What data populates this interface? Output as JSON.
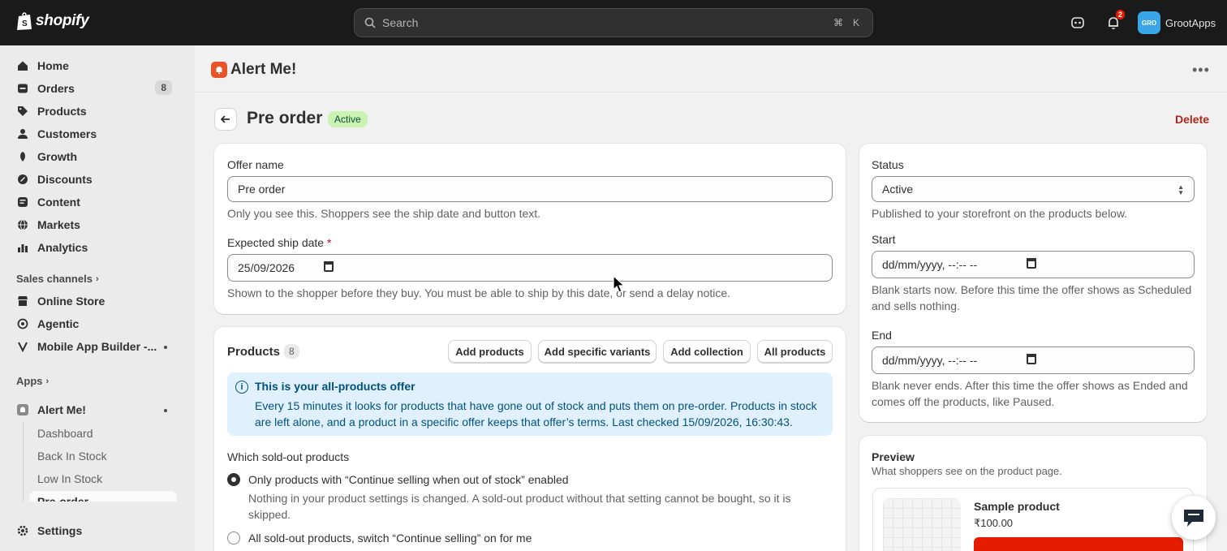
{
  "topbar": {
    "logo_text": "shopify",
    "search_placeholder": "Search",
    "kbd_cmd": "⌘",
    "kbd_k": "K",
    "notification_count": "2",
    "store_initials": "GRO",
    "store_name": "GrootApps"
  },
  "sidebar": {
    "items": [
      {
        "label": "Home",
        "icon": "home-icon"
      },
      {
        "label": "Orders",
        "icon": "orders-icon",
        "count": "8"
      },
      {
        "label": "Products",
        "icon": "tag-icon"
      },
      {
        "label": "Customers",
        "icon": "person-icon"
      },
      {
        "label": "Growth",
        "icon": "growth-icon"
      },
      {
        "label": "Discounts",
        "icon": "discount-icon"
      },
      {
        "label": "Content",
        "icon": "content-icon"
      },
      {
        "label": "Markets",
        "icon": "globe-icon"
      },
      {
        "label": "Analytics",
        "icon": "chart-icon"
      }
    ],
    "sales_channels_label": "Sales channels",
    "channels": [
      {
        "label": "Online Store",
        "icon": "store-icon"
      },
      {
        "label": "Agentic",
        "icon": "agentic-icon"
      },
      {
        "label": "Mobile App Builder -...",
        "icon": "mobile-app-icon"
      }
    ],
    "apps_label": "Apps",
    "app": {
      "label": "Alert Me!",
      "icon": "alert-me-app-icon"
    },
    "app_subitems": [
      "Dashboard",
      "Back In Stock",
      "Low In Stock",
      "Pre-order"
    ],
    "settings_label": "Settings"
  },
  "header": {
    "app_title": "Alert Me!",
    "more_label": "•••"
  },
  "page": {
    "title": "Pre order",
    "status_badge": "Active",
    "delete_label": "Delete"
  },
  "offer": {
    "name_label": "Offer name",
    "name_value": "Pre order",
    "name_help": "Only you see this. Shoppers see the ship date and button text.",
    "ship_label": "Expected ship date",
    "ship_required": "*",
    "ship_value": "25/09/2026",
    "ship_help": "Shown to the shopper before they buy. You must be able to ship by this date, or send a delay notice."
  },
  "products": {
    "title": "Products",
    "count": "8",
    "buttons": [
      "Add products",
      "Add specific variants",
      "Add collection",
      "All products"
    ],
    "banner_title": "This is your all-products offer",
    "banner_body": "Every 15 minutes it looks for products that have gone out of stock and puts them on pre-order. Products in stock are left alone, and a product in a specific offer keeps that offer’s terms. Last checked 15/09/2026, 16:30:43.",
    "which_label": "Which sold-out products",
    "option1_label": "Only products with “Continue selling when out of stock” enabled",
    "option1_help": "Nothing in your product settings is changed. A sold-out product without that setting cannot be bought, so it is skipped.",
    "option2_label": "All sold-out products, switch “Continue selling” on for me"
  },
  "status_card": {
    "status_label": "Status",
    "status_value": "Active",
    "status_help": "Published to your storefront on the products below.",
    "start_label": "Start",
    "start_value": "dd/mm/yyyy, --:-- --",
    "start_help": "Blank starts now. Before this time the offer shows as Scheduled and sells nothing.",
    "end_label": "End",
    "end_value": "dd/mm/yyyy, --:-- --",
    "end_help": "Blank never ends. After this time the offer shows as Ended and comes off the products, like Paused."
  },
  "preview": {
    "title": "Preview",
    "subtitle": "What shoppers see on the product page.",
    "product_name": "Sample product",
    "product_price": "₹100.00"
  },
  "colors": {
    "topbar": "#1a1a1a",
    "badge_active_bg": "#c9f2b3",
    "delete": "#b32519",
    "banner_bg": "#e0f0ff",
    "preview_button": "#e51c00"
  }
}
